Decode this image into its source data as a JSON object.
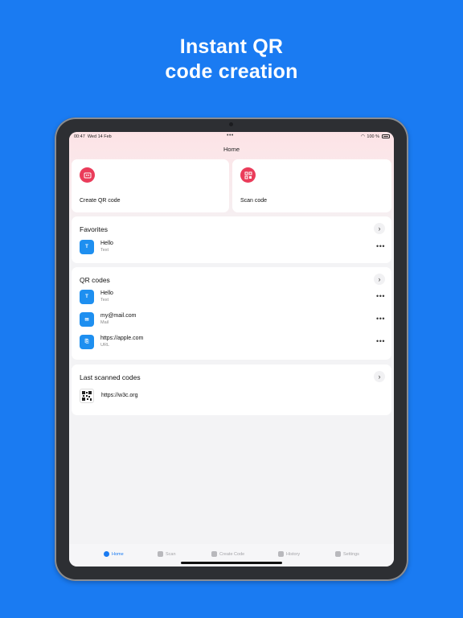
{
  "promo": {
    "line1": "Instant QR",
    "line2": "code creation"
  },
  "status": {
    "time": "00:47",
    "date": "Wed 14 Feb",
    "battery": "100 %"
  },
  "nav": {
    "title": "Home"
  },
  "actions": [
    {
      "label": "Create QR code",
      "icon": "create-qr-icon"
    },
    {
      "label": "Scan code",
      "icon": "scan-icon"
    }
  ],
  "favorites": {
    "title": "Favorites",
    "items": [
      {
        "title": "Hello",
        "subtitle": "Text",
        "icon_letter": "T"
      }
    ]
  },
  "qrcodes": {
    "title": "QR codes",
    "items": [
      {
        "title": "Hello",
        "subtitle": "Text",
        "icon_letter": "T"
      },
      {
        "title": "my@mail.com",
        "subtitle": "Mail",
        "icon_letter": "✉"
      },
      {
        "title": "https://apple.com",
        "subtitle": "URL",
        "icon_letter": "⎘"
      }
    ]
  },
  "scanned": {
    "title": "Last scanned codes",
    "items": [
      {
        "url": "https://w3c.org"
      }
    ]
  },
  "tabs": [
    {
      "label": "Home",
      "active": true
    },
    {
      "label": "Scan",
      "active": false
    },
    {
      "label": "Create Code",
      "active": false
    },
    {
      "label": "History",
      "active": false
    },
    {
      "label": "Settings",
      "active": false
    }
  ],
  "colors": {
    "background": "#1a7bf2",
    "accent_red": "#ea3c5a",
    "icon_blue": "#1e8ff0"
  }
}
